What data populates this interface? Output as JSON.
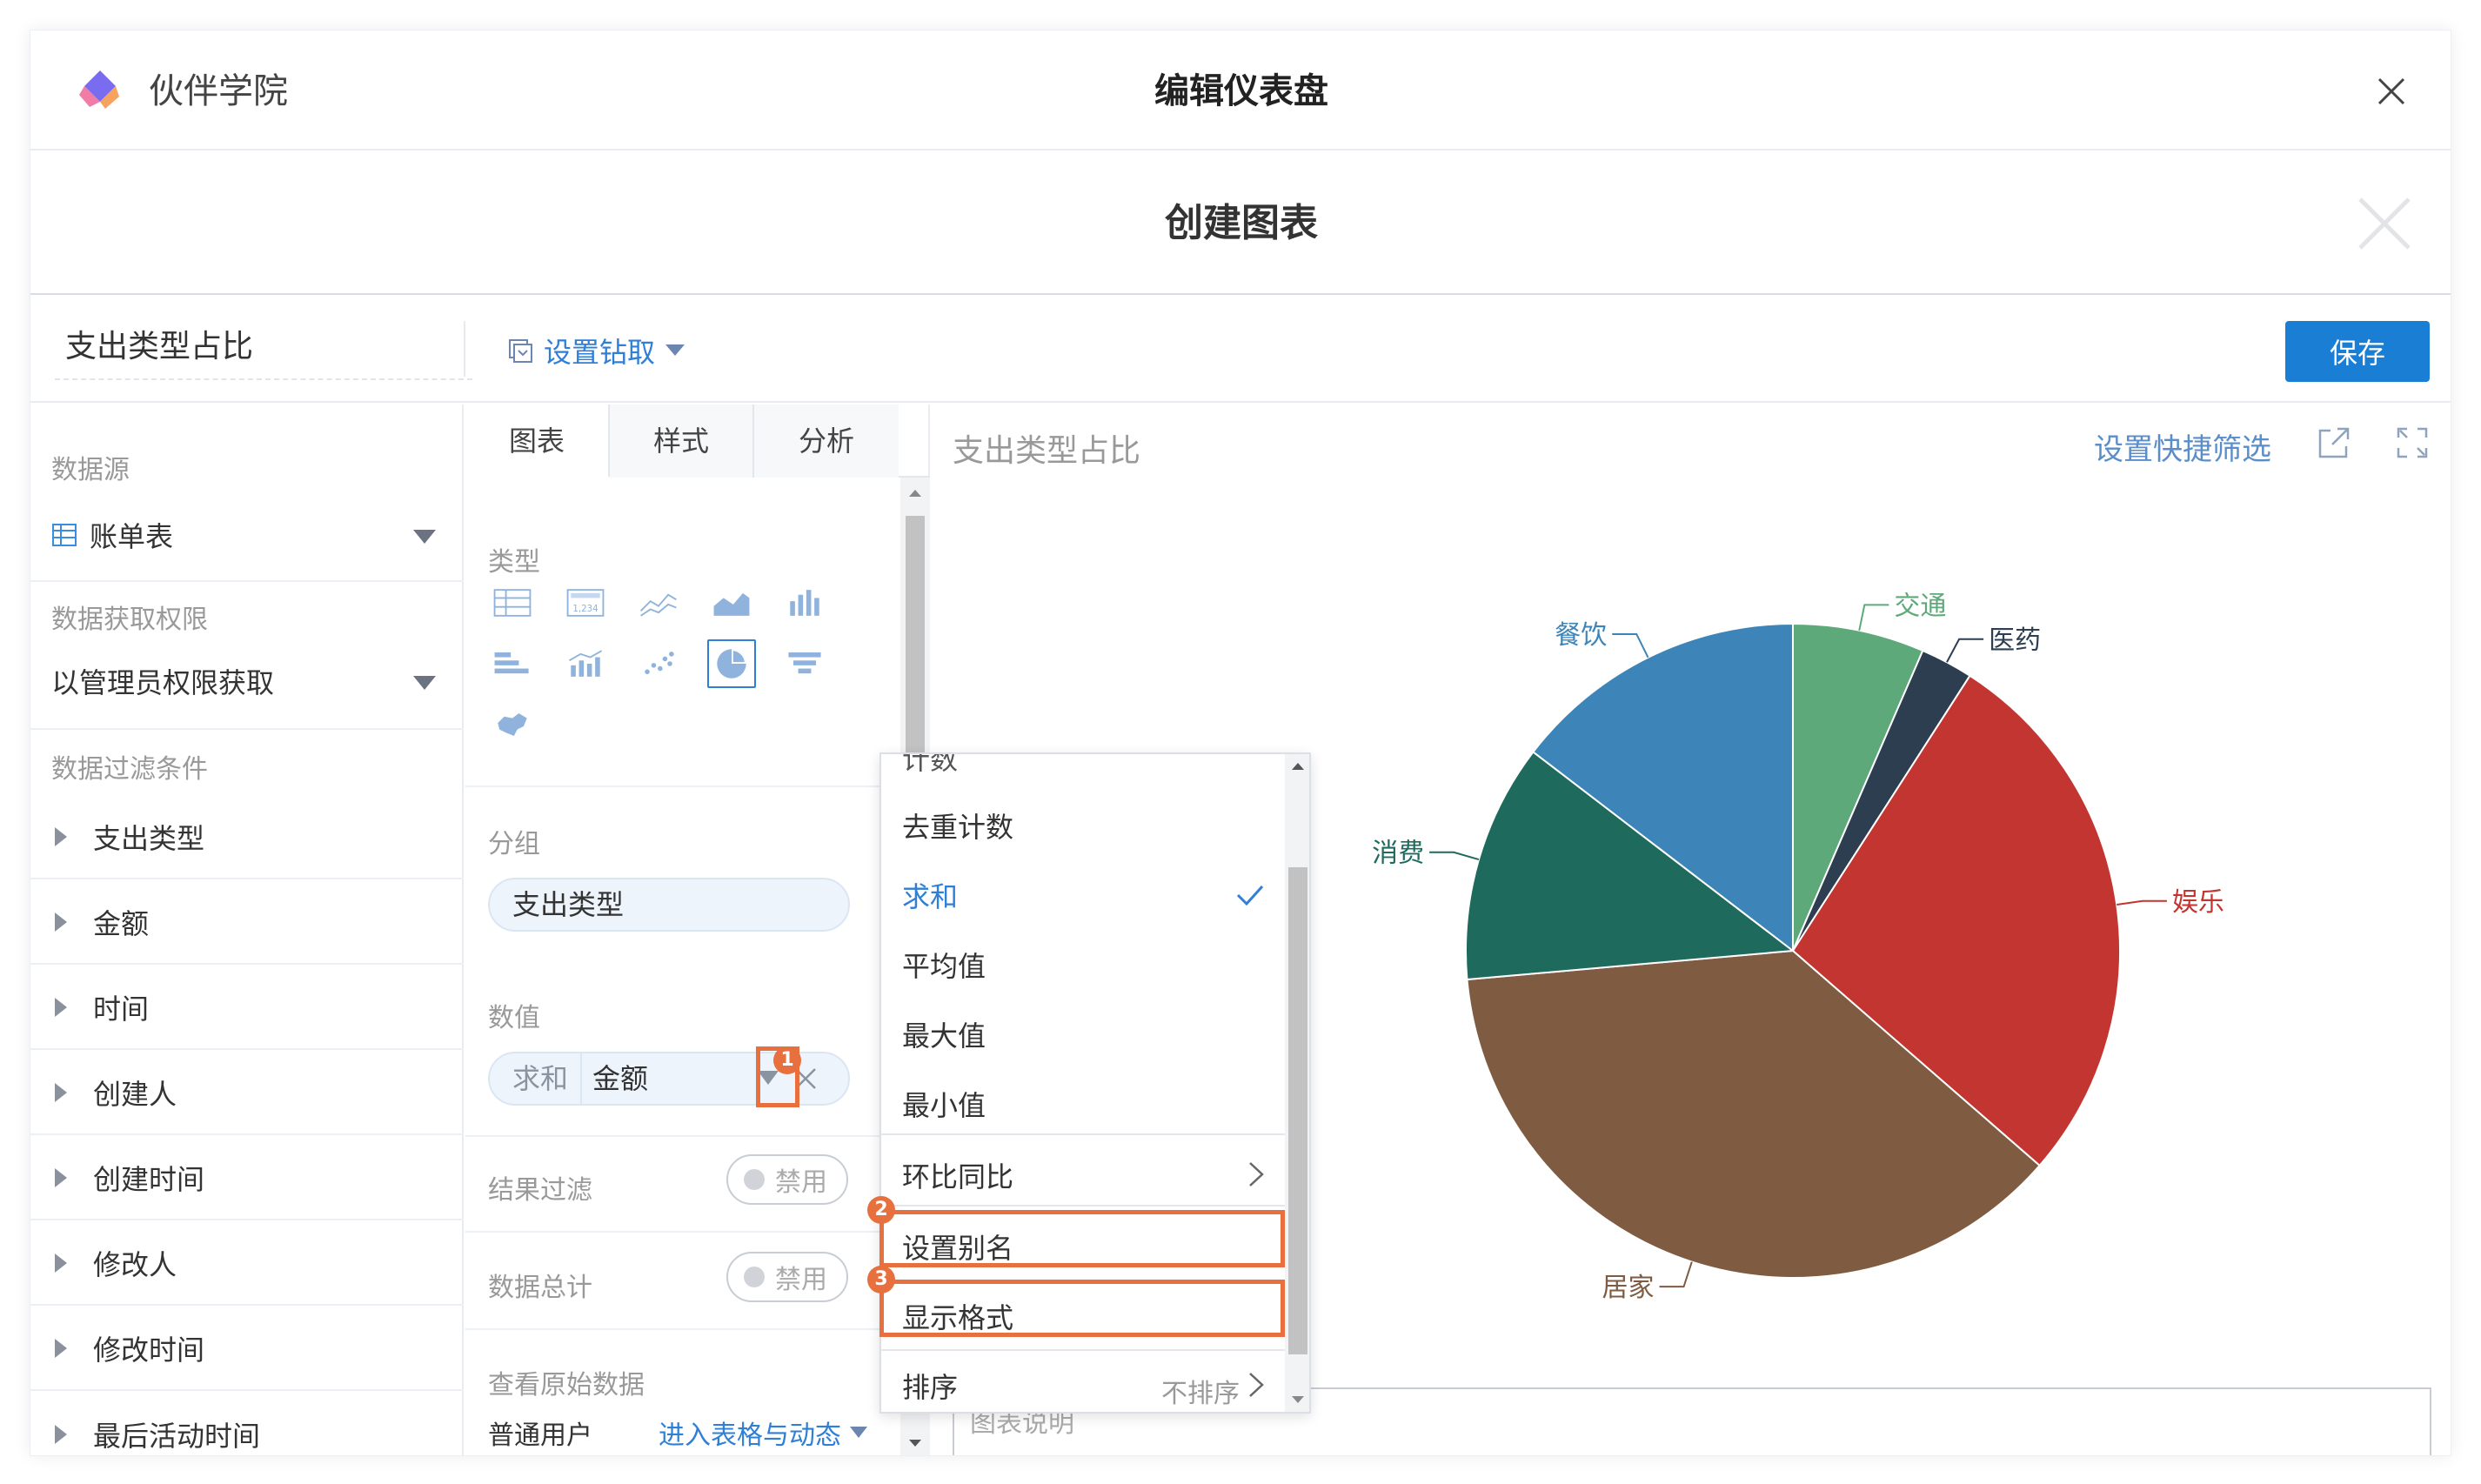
{
  "app": {
    "name": "伙伴学院",
    "dashboard_title": "编辑仪表盘"
  },
  "dialog": {
    "title": "创建图表"
  },
  "toolbar": {
    "chart_name": "支出类型占比",
    "drill_label": "设置钻取",
    "save_label": "保存"
  },
  "left": {
    "datasource_label": "数据源",
    "datasource_value": "账单表",
    "permission_label": "数据获取权限",
    "permission_value": "以管理员权限获取",
    "filter_label": "数据过滤条件",
    "fields": [
      "支出类型",
      "金额",
      "时间",
      "创建人",
      "创建时间",
      "修改人",
      "修改时间",
      "最后活动时间"
    ]
  },
  "middle": {
    "tabs": [
      "图表",
      "样式",
      "分析"
    ],
    "type_label": "类型",
    "group_label": "分组",
    "group_value": "支出类型",
    "value_label": "数值",
    "value_agg": "求和",
    "value_field": "金额",
    "result_filter_label": "结果过滤",
    "total_label": "数据总计",
    "toggle_text": "禁用",
    "raw_data_label": "查看原始数据",
    "raw_user": "普通用户",
    "raw_link": "进入表格与动态"
  },
  "menu": {
    "partial_top": "计数",
    "items": [
      "去重计数",
      "求和",
      "平均值",
      "最大值",
      "最小值",
      "环比同比",
      "设置别名",
      "显示格式",
      "排序"
    ],
    "active_item": "求和",
    "sort_sub": "不排序"
  },
  "badges": [
    "1",
    "2",
    "3"
  ],
  "preview": {
    "title": "支出类型占比",
    "quick_filter": "设置快捷筛选",
    "desc_placeholder": "图表说明"
  },
  "chart_data": {
    "type": "pie",
    "title": "支出类型占比",
    "slices": [
      {
        "label": "交通",
        "value": 6.5,
        "color": "#5ea979"
      },
      {
        "label": "医药",
        "value": 2.6,
        "color": "#2c3e50"
      },
      {
        "label": "娱乐",
        "value": 27.3,
        "color": "#c23531"
      },
      {
        "label": "居家",
        "value": 37.2,
        "color": "#7f5b42"
      },
      {
        "label": "消费",
        "value": 11.8,
        "color": "#1e6b5e"
      },
      {
        "label": "餐饮",
        "value": 14.6,
        "color": "#3d85b8"
      }
    ]
  },
  "colors": {
    "accent": "#1a7fd4",
    "highlight": "#e8703e",
    "link": "#2f7fd6"
  }
}
